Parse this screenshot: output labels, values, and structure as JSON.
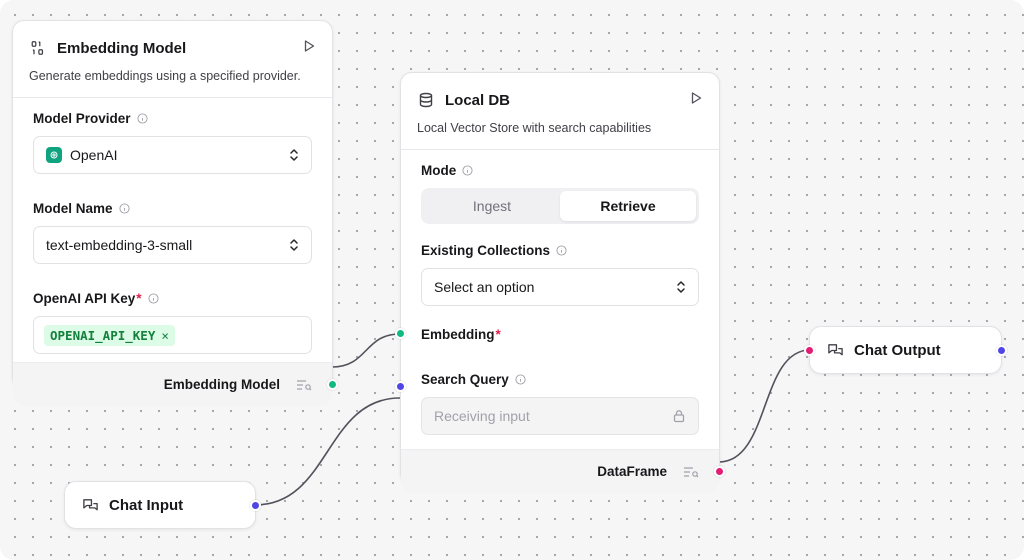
{
  "colors": {
    "green_handle": "#10b981",
    "blue_handle": "#4f46e5",
    "pink_handle": "#e11d74",
    "edge": "#52525b"
  },
  "embedding_node": {
    "title": "Embedding Model",
    "icon": "binary-icon",
    "description": "Generate embeddings using a specified provider.",
    "provider_label": "Model Provider",
    "provider_value": "OpenAI",
    "provider_icon": "openai-icon",
    "model_label": "Model Name",
    "model_value": "text-embedding-3-small",
    "apikey_label": "OpenAI API Key",
    "apikey_required": "*",
    "apikey_chip": "OPENAI_API_KEY",
    "chip_remove": "×",
    "output_label": "Embedding Model"
  },
  "localdb_node": {
    "title": "Local DB",
    "icon": "database-icon",
    "description": "Local Vector Store with search capabilities",
    "mode_label": "Mode",
    "mode_options": [
      "Ingest",
      "Retrieve"
    ],
    "mode_selected": "Retrieve",
    "collections_label": "Existing Collections",
    "collections_placeholder": "Select an option",
    "embedding_label": "Embedding",
    "embedding_required": "*",
    "query_label": "Search Query",
    "query_placeholder": "Receiving input",
    "output_label": "DataFrame"
  },
  "chat_input_node": {
    "title": "Chat Input",
    "icon": "chat-icon"
  },
  "chat_output_node": {
    "title": "Chat Output",
    "icon": "chat-icon"
  }
}
